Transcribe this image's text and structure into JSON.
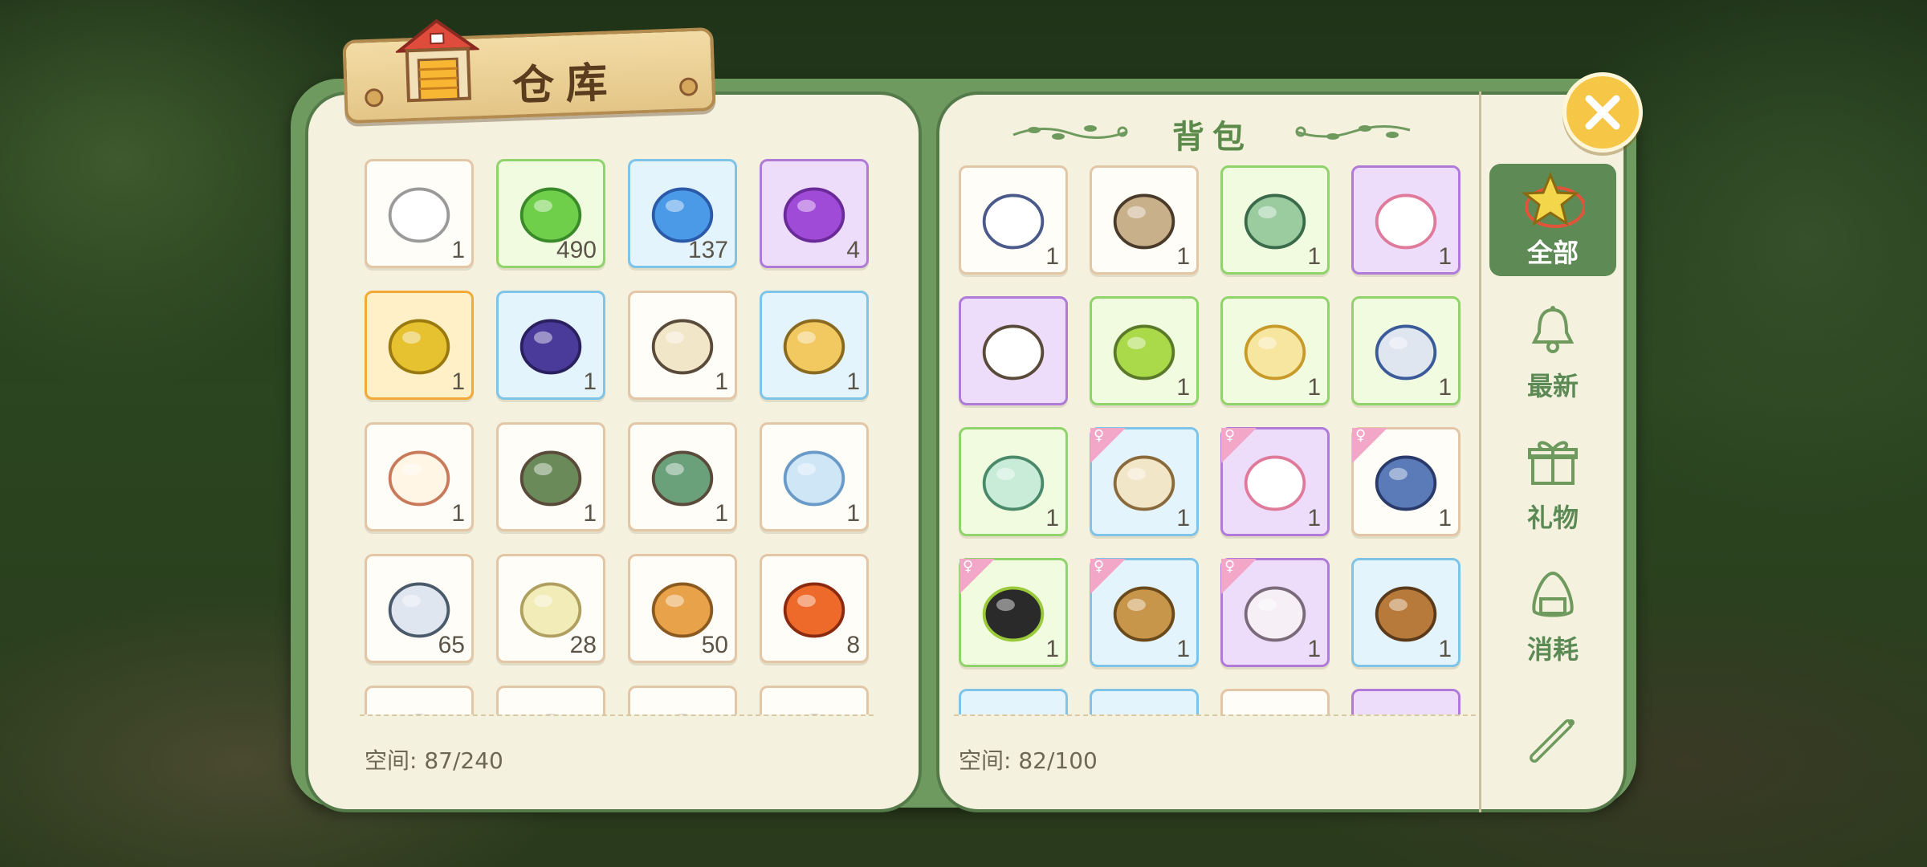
{
  "warehouse": {
    "title": "仓库",
    "space_label": "空间: 87/240",
    "items": [
      {
        "icon": "paper-roll-icon",
        "rarity": "white",
        "count": "1"
      },
      {
        "icon": "green-cabbage-seed-icon",
        "rarity": "green",
        "count": "490"
      },
      {
        "icon": "blue-cabbage-seed-icon",
        "rarity": "blue",
        "count": "137"
      },
      {
        "icon": "purple-cabbage-seed-icon",
        "rarity": "purple",
        "count": "4"
      },
      {
        "icon": "gold-cabbage-seed-icon",
        "rarity": "orange",
        "count": "1"
      },
      {
        "icon": "slingshot-icon",
        "rarity": "blue",
        "count": "1"
      },
      {
        "icon": "bug-net-icon",
        "rarity": "white",
        "count": "1"
      },
      {
        "icon": "golden-bug-net-icon",
        "rarity": "blue",
        "count": "1"
      },
      {
        "icon": "letter-icon",
        "rarity": "white",
        "count": "1"
      },
      {
        "icon": "photo-icon",
        "rarity": "white",
        "count": "1"
      },
      {
        "icon": "house-photo-icon",
        "rarity": "white",
        "count": "1"
      },
      {
        "icon": "blue-letter-icon",
        "rarity": "white",
        "count": "1"
      },
      {
        "icon": "birch-log-icon",
        "rarity": "white",
        "count": "65"
      },
      {
        "icon": "potato-icon",
        "rarity": "white",
        "count": "28"
      },
      {
        "icon": "wood-log-icon",
        "rarity": "white",
        "count": "50"
      },
      {
        "icon": "amber-stone-icon",
        "rarity": "white",
        "count": "8"
      },
      {
        "icon": "item-icon",
        "rarity": "white",
        "count": ""
      },
      {
        "icon": "item-icon",
        "rarity": "white",
        "count": ""
      },
      {
        "icon": "item-icon",
        "rarity": "white",
        "count": ""
      },
      {
        "icon": "item-icon",
        "rarity": "white",
        "count": ""
      }
    ]
  },
  "backpack": {
    "title": "背包",
    "space_label": "空间: 82/100",
    "items": [
      {
        "icon": "sailor-beret-icon",
        "rarity": "white",
        "count": "1",
        "gender": false
      },
      {
        "icon": "miner-helmet-icon",
        "rarity": "white",
        "count": "1",
        "gender": false
      },
      {
        "icon": "straw-hat-icon",
        "rarity": "green",
        "count": "1",
        "gender": false
      },
      {
        "icon": "bunny-mask-icon",
        "rarity": "purple",
        "count": "1",
        "gender": false
      },
      {
        "icon": "unicorn-mask-icon",
        "rarity": "purple",
        "count": "",
        "gender": false
      },
      {
        "icon": "face-mask-icon",
        "rarity": "green",
        "count": "1",
        "gender": false
      },
      {
        "icon": "goggles-icon",
        "rarity": "green",
        "count": "1",
        "gender": false
      },
      {
        "icon": "scarf-sweater-icon",
        "rarity": "green",
        "count": "1",
        "gender": false
      },
      {
        "icon": "long-coat-icon",
        "rarity": "green",
        "count": "1",
        "gender": false
      },
      {
        "icon": "vest-jacket-icon",
        "rarity": "blue",
        "count": "1",
        "gender": true
      },
      {
        "icon": "bunny-onesie-icon",
        "rarity": "purple",
        "count": "1",
        "gender": true
      },
      {
        "icon": "denim-shorts-icon",
        "rarity": "white",
        "count": "1",
        "gender": true
      },
      {
        "icon": "black-pants-icon",
        "rarity": "green",
        "count": "1",
        "gender": true
      },
      {
        "icon": "pleated-skirt-icon",
        "rarity": "blue",
        "count": "1",
        "gender": true
      },
      {
        "icon": "bunny-slippers-icon",
        "rarity": "purple",
        "count": "1",
        "gender": true
      },
      {
        "icon": "backpack-icon",
        "rarity": "blue",
        "count": "1",
        "gender": false
      },
      {
        "icon": "item-icon",
        "rarity": "blue",
        "count": "",
        "gender": false
      },
      {
        "icon": "item-icon",
        "rarity": "blue",
        "count": "",
        "gender": false
      },
      {
        "icon": "item-icon",
        "rarity": "white",
        "count": "",
        "gender": false
      },
      {
        "icon": "item-icon",
        "rarity": "purple",
        "count": "",
        "gender": false
      }
    ]
  },
  "tabs": [
    {
      "label": "全部",
      "icon": "star-icon",
      "active": true
    },
    {
      "label": "最新",
      "icon": "bell-icon",
      "active": false
    },
    {
      "label": "礼物",
      "icon": "gift-icon",
      "active": false
    },
    {
      "label": "消耗",
      "icon": "rice-ball-icon",
      "active": false
    },
    {
      "label": "",
      "icon": "scroll-icon",
      "active": false
    }
  ],
  "colors": {
    "book_green": "#6e9a60",
    "page": "#f4f1df",
    "tab_active": "#5d8a55",
    "close_button": "#f6c646"
  }
}
